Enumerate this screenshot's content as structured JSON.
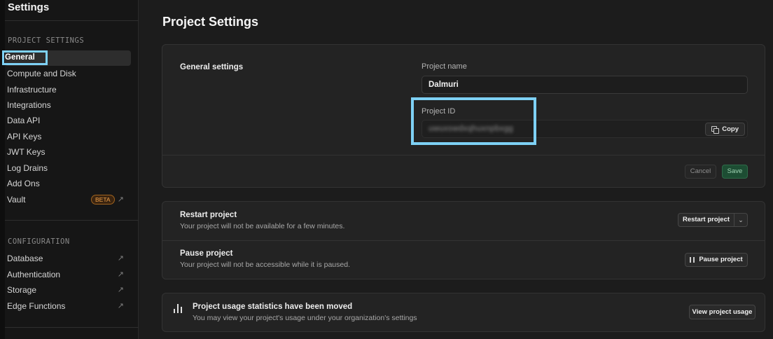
{
  "sidebar": {
    "title": "Settings",
    "project_section": "PROJECT SETTINGS",
    "items": [
      {
        "label": "General"
      },
      {
        "label": "Compute and Disk"
      },
      {
        "label": "Infrastructure"
      },
      {
        "label": "Integrations"
      },
      {
        "label": "Data API"
      },
      {
        "label": "API Keys"
      },
      {
        "label": "JWT Keys"
      },
      {
        "label": "Log Drains"
      },
      {
        "label": "Add Ons"
      },
      {
        "label": "Vault",
        "badge": "BETA"
      }
    ],
    "config_section": "CONFIGURATION",
    "config_items": [
      {
        "label": "Database"
      },
      {
        "label": "Authentication"
      },
      {
        "label": "Storage"
      },
      {
        "label": "Edge Functions"
      }
    ],
    "external_glyph": "↗"
  },
  "main": {
    "title": "Project Settings",
    "general": {
      "section_label": "General settings",
      "project_name_label": "Project name",
      "project_name_value": "Dalmuri",
      "project_id_label": "Project ID",
      "project_id_value": "uwuxswdxqhuxnpbxgg",
      "copy_label": "Copy",
      "cancel_label": "Cancel",
      "save_label": "Save"
    },
    "restart": {
      "title": "Restart project",
      "description": "Your project will not be available for a few minutes.",
      "button_label": "Restart project",
      "chevron": "⌄"
    },
    "pause": {
      "title": "Pause project",
      "description": "Your project will not be accessible while it is paused.",
      "button_label": "Pause project"
    },
    "usage": {
      "title": "Project usage statistics have been moved",
      "description": "You may view your project's usage under your organization's settings",
      "button_label": "View project usage"
    }
  },
  "colors": {
    "highlight": "#7ed1f5",
    "save_green": "#1d4d33",
    "beta_orange": "#f0a14a"
  }
}
